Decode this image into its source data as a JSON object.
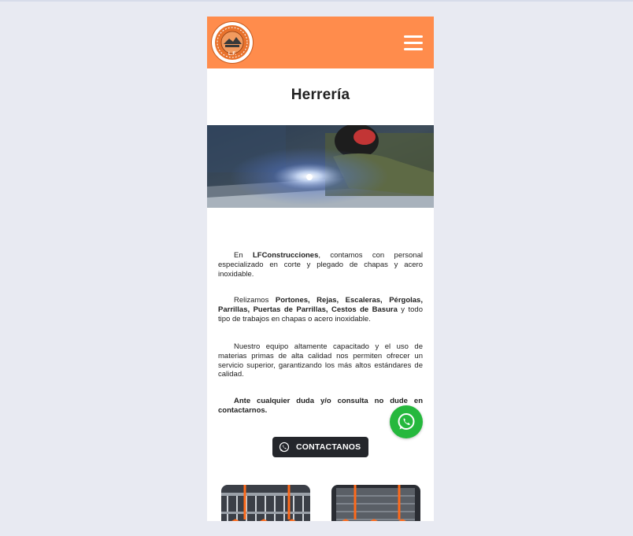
{
  "header": {
    "logo_name": "lf-construcciones-logo",
    "menu_icon": "hamburger-menu-icon",
    "brand_color": "#ff8c4c"
  },
  "page": {
    "title": "Herrería",
    "hero_icon": "welding-photo"
  },
  "content": {
    "p1": {
      "pre": "En ",
      "strong": "LFConstrucciones",
      "post": ", contamos con personal especializado en corte y plegado de chapas y acero inoxidable."
    },
    "p2": {
      "pre": "Relizamos ",
      "strong": "Portones, Rejas, Escaleras, Pérgolas, Parrillas, Puertas de Parrillas, Cestos de Basura",
      "post": " y todo tipo de trabajos en chapas o acero inoxidable."
    },
    "p3": {
      "text": "Nuestro equipo altamente capacitado y el uso de materias primas de alta calidad nos permiten ofrecer un servicio superior, garantizando los más altos estándares de calidad."
    },
    "p4": {
      "strong": "Ante cualquier duda y/o consulta no dude en contactarnos."
    }
  },
  "cta": {
    "label": "CONTACTANOS",
    "icon": "whatsapp-icon",
    "bg": "#24262b"
  },
  "floating_whatsapp": {
    "icon": "whatsapp-icon",
    "color": "#25b83d"
  },
  "gallery": {
    "items": [
      "gallery-thumb-1",
      "gallery-thumb-2"
    ]
  }
}
